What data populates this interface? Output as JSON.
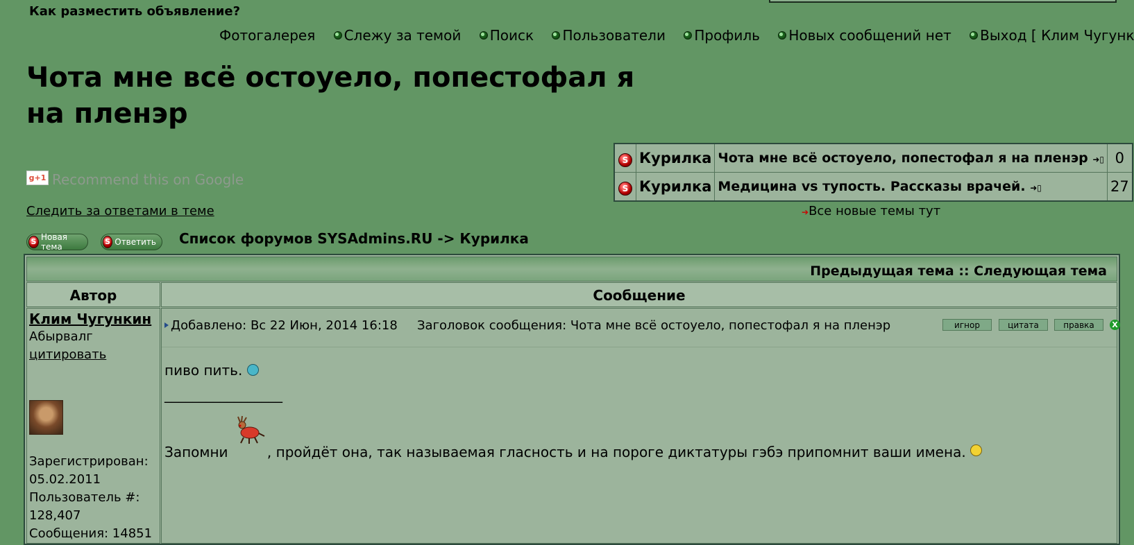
{
  "top": {
    "how_to_post": "Как разместить объявление?"
  },
  "nav": {
    "items": [
      {
        "label": "Фотогалерея",
        "icon": "none"
      },
      {
        "label": "Слежу за темой",
        "icon": "green-bullet-icon"
      },
      {
        "label": "Поиск",
        "icon": "green-bullet-icon"
      },
      {
        "label": "Пользователи",
        "icon": "green-bullet-icon"
      },
      {
        "label": "Профиль",
        "icon": "green-bullet-icon"
      },
      {
        "label": "Новых сообщений нет",
        "icon": "green-bullet-icon"
      },
      {
        "label": "Выход [ Клим Чугункин ]",
        "icon": "green-bullet-icon"
      }
    ]
  },
  "topic": {
    "title_line1": "Чота мне всё остоуело, попестофал я",
    "title_line2": "на пленэр",
    "gplus_label": "g+1",
    "recommend": "Recommend this on Google",
    "follow_link": "Следить за ответами в теме"
  },
  "new_topics": {
    "rows": [
      {
        "forum": "Курилка",
        "topic": "Чота мне всё остоуело, попестофал я на пленэр",
        "count": "0"
      },
      {
        "forum": "Курилка",
        "topic": "Медицина vs тупость. Рассказы врачей.",
        "count": "27"
      }
    ],
    "all_new": "Все новые темы тут"
  },
  "actions": {
    "new_topic": "Новая тема",
    "reply": "Ответить",
    "breadcrumb": "Список форумов SYSAdmins.RU -> Курилка"
  },
  "thread": {
    "prevnext": "Предыдущая тема :: Следующая тема",
    "col_author": "Автор",
    "col_message": "Сообщение"
  },
  "post": {
    "author": "Клим Чугункин",
    "rank": "Абырвалг",
    "quote_link": "цитировать",
    "registered_label": "Зарегистрирован:",
    "registered_date": "05.02.2011",
    "user_num_label": "Пользователь #:",
    "user_num": "128,407",
    "posts_count": "Сообщения: 14851",
    "added": "Добавлено: Вс 22 Июн, 2014 16:18",
    "subject": "Заголовок сообщения: Чота мне всё остоуело, попестофал я на пленэр",
    "btn_ignore": "игнор",
    "btn_quote": "цитата",
    "btn_edit": "правка",
    "close_glyph": "X",
    "body_line": "пиво пить.",
    "sig_rule": "_________________",
    "sig_prefix": "Запомни",
    "sig_text": ", пройдёт она, так называемая гласность и на пороге диктатуры гэбэ припомнит ваши имена."
  },
  "colors": {
    "page_bg": "#629664",
    "table_bg": "#9cb49c",
    "border": "#2c4a3c"
  }
}
